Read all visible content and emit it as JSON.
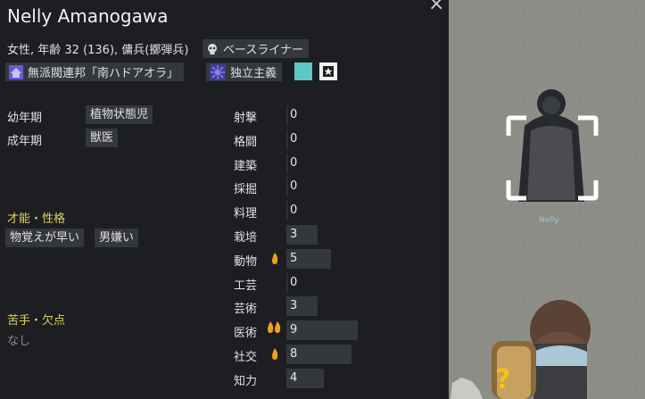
{
  "header": {
    "name": "Nelly Amanogawa",
    "close_glyph": "×"
  },
  "description": "女性, 年齢 32 (136), 傭兵(擲弾兵)",
  "ideology_chip": {
    "label": "ベースライナー",
    "icon": "skull-icon"
  },
  "faction_chip": {
    "label": "無派閥連邦「南ハドアオラ」",
    "icon": "faction-house-icon"
  },
  "ideoligion_chip": {
    "label": "独立主義",
    "icon": "ideoligion-icon"
  },
  "favorite_color": "#5fc7c5",
  "backstory": {
    "childhood": {
      "label": "幼年期",
      "value": "植物状態児"
    },
    "adulthood": {
      "label": "成年期",
      "value": "獣医"
    }
  },
  "traits": {
    "title": "才能・性格",
    "items": [
      "物覚えが早い",
      "男嫌い"
    ]
  },
  "incapable": {
    "title": "苦手・欠点",
    "none": "なし"
  },
  "skills": [
    {
      "name": "射撃",
      "level": 0,
      "passion": 0
    },
    {
      "name": "格闘",
      "level": 0,
      "passion": 0
    },
    {
      "name": "建築",
      "level": 0,
      "passion": 0
    },
    {
      "name": "採掘",
      "level": 0,
      "passion": 0
    },
    {
      "name": "料理",
      "level": 0,
      "passion": 0
    },
    {
      "name": "栽培",
      "level": 3,
      "passion": 0
    },
    {
      "name": "動物",
      "level": 5,
      "passion": 1
    },
    {
      "name": "工芸",
      "level": 0,
      "passion": 0
    },
    {
      "name": "芸術",
      "level": 3,
      "passion": 0
    },
    {
      "name": "医術",
      "level": 9,
      "passion": 2
    },
    {
      "name": "社交",
      "level": 8,
      "passion": 1
    },
    {
      "name": "知力",
      "level": 4,
      "passion": 0
    }
  ],
  "map": {
    "pawn_label": "Nelly",
    "alert_glyph": "?"
  },
  "colors": {
    "passion_flame": "#f0a020",
    "section_heading": "#e3d15a",
    "selection_bracket": "#ffffff"
  }
}
